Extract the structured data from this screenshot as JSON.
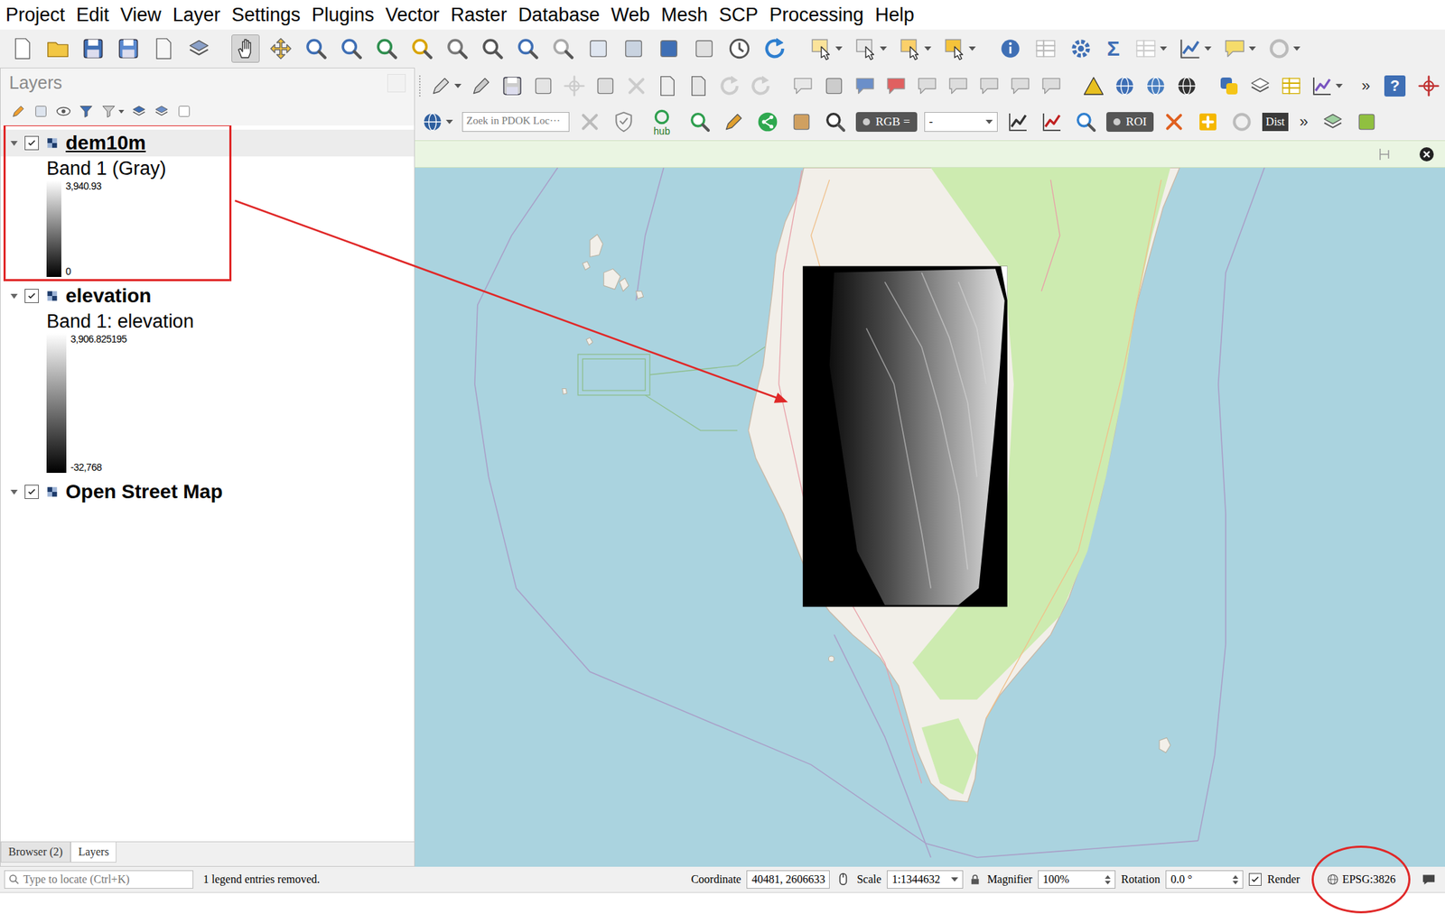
{
  "menu": [
    "Project",
    "Edit",
    "View",
    "Layer",
    "Settings",
    "Plugins",
    "Vector",
    "Raster",
    "Database",
    "Web",
    "Mesh",
    "SCP",
    "Processing",
    "Help"
  ],
  "toolbar": {
    "active_tool": "pan",
    "sigma": "Σ"
  },
  "toolbar2": {
    "overflow": "»",
    "help": "?"
  },
  "plugin_bar": {
    "search_placeholder": "Zoek in PDOK Loc···",
    "hub": "hub",
    "rgb_label": "RGB =",
    "rgb_value": "-",
    "roi": "ROI",
    "dist": "Dist",
    "overflow": "»"
  },
  "layers_panel": {
    "title": "Layers",
    "layers": [
      {
        "name": "dem10m",
        "checked": true,
        "expanded": true,
        "selected": true,
        "legend": {
          "band": "Band 1 (Gray)",
          "max": "3,940.93",
          "min": "0"
        }
      },
      {
        "name": "elevation",
        "checked": true,
        "expanded": true,
        "selected": false,
        "legend": {
          "band": "Band 1: elevation",
          "max": "3,906.825195",
          "min": "-32,768"
        }
      },
      {
        "name": "Open Street Map",
        "checked": true,
        "expanded": true,
        "selected": false,
        "legend": null
      }
    ]
  },
  "panel_tabs": [
    {
      "label": "Browser (2)",
      "selected": false
    },
    {
      "label": "Layers",
      "selected": true
    }
  ],
  "status_bar": {
    "locator_placeholder": "Type to locate (Ctrl+K)",
    "message": "1 legend entries removed.",
    "coordinate_label": "Coordinate",
    "coordinate": "40481, 2606633",
    "scale_label": "Scale",
    "scale": "1:1344632",
    "magnifier_label": "Magnifier",
    "magnifier": "100%",
    "rotation_label": "Rotation",
    "rotation": "0.0 °",
    "render_label": "Render",
    "render_checked": true,
    "crs": "EPSG:3826"
  }
}
